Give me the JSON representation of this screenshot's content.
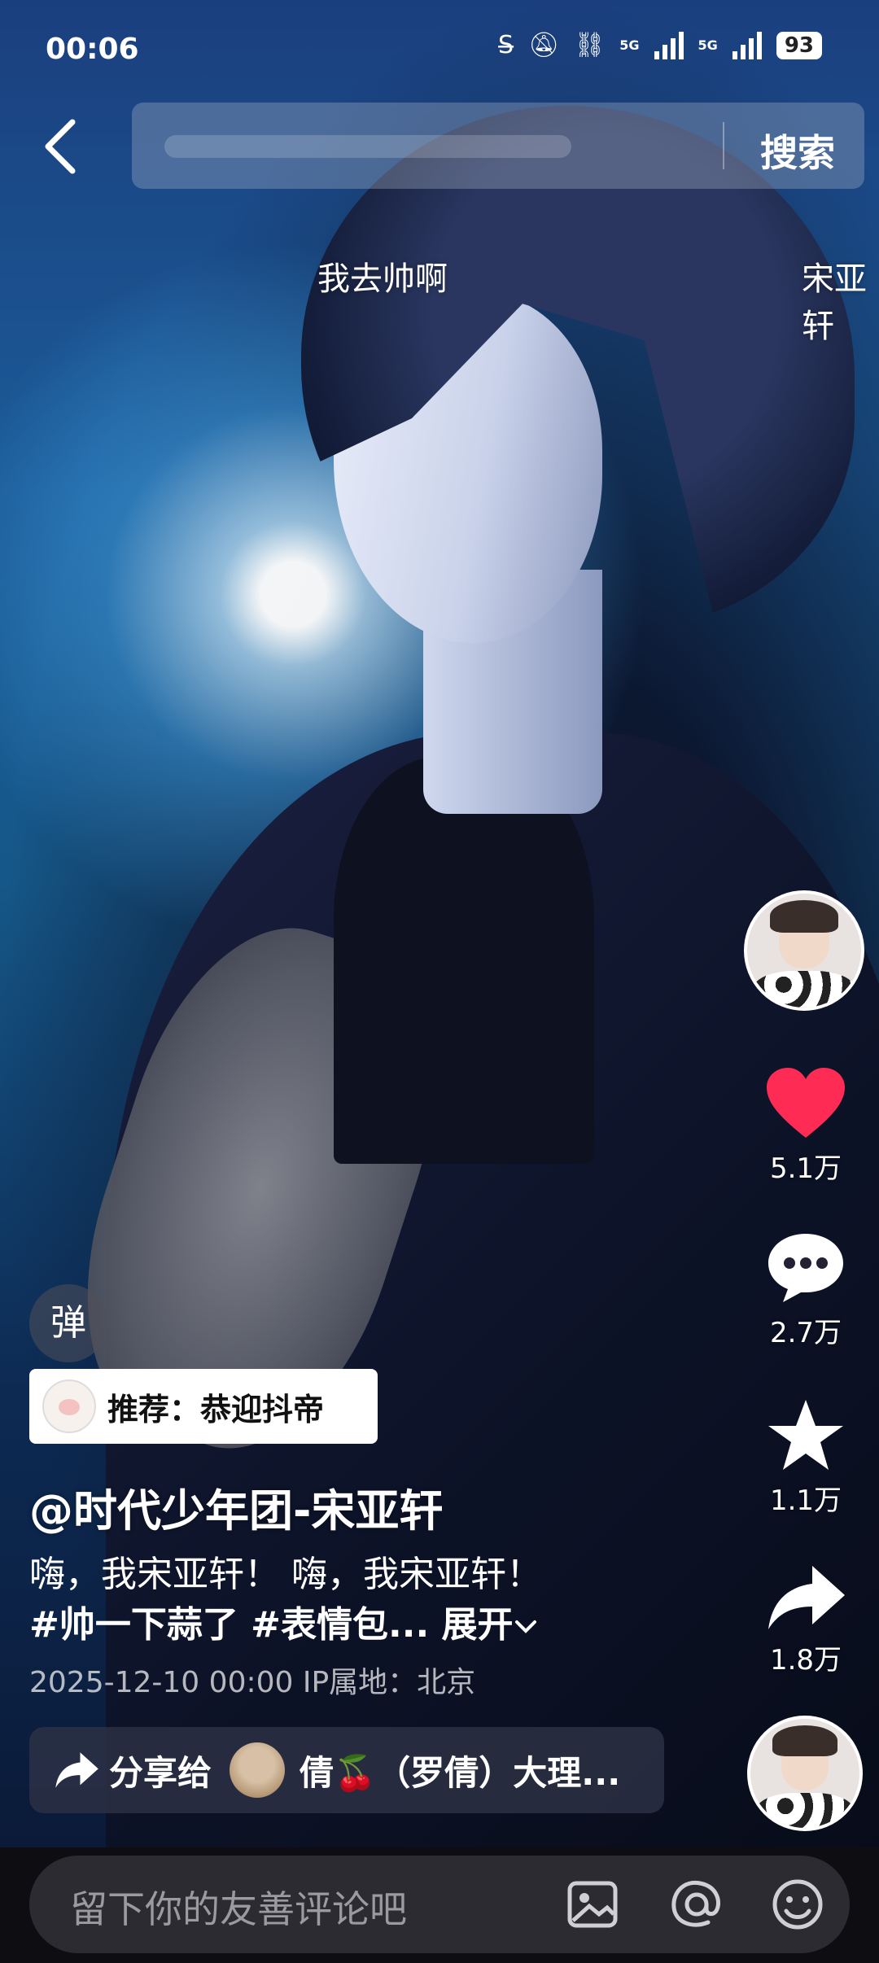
{
  "status_bar": {
    "time": "00:06",
    "network_1": "5G",
    "network_2": "5G",
    "battery": "93"
  },
  "header": {
    "back_icon": "chevron-left-icon",
    "search_button": "搜索"
  },
  "hot_words": [
    "我去帅啊",
    "宋亚轩"
  ],
  "actions": {
    "like_count": "5.1万",
    "comment_count": "2.7万",
    "favorite_count": "1.1万",
    "share_count": "1.8万",
    "like_color": "#fe2c55"
  },
  "danmu_button": "弹",
  "recommend_chip": "推荐：恭迎抖帝",
  "post": {
    "author": "@时代少年团-宋亚轩",
    "line1": "嗨，我宋亚轩！  嗨，我宋亚轩！",
    "hashtags": "#帅一下蒜了 #表情包...",
    "expand": "展开",
    "meta": "2025-12-10 00:00  IP属地：北京"
  },
  "share_bar": {
    "label": "分享给",
    "friend": "倩🍒（罗倩）大理..."
  },
  "comment_bar": {
    "placeholder": "留下你的友善评论吧"
  }
}
